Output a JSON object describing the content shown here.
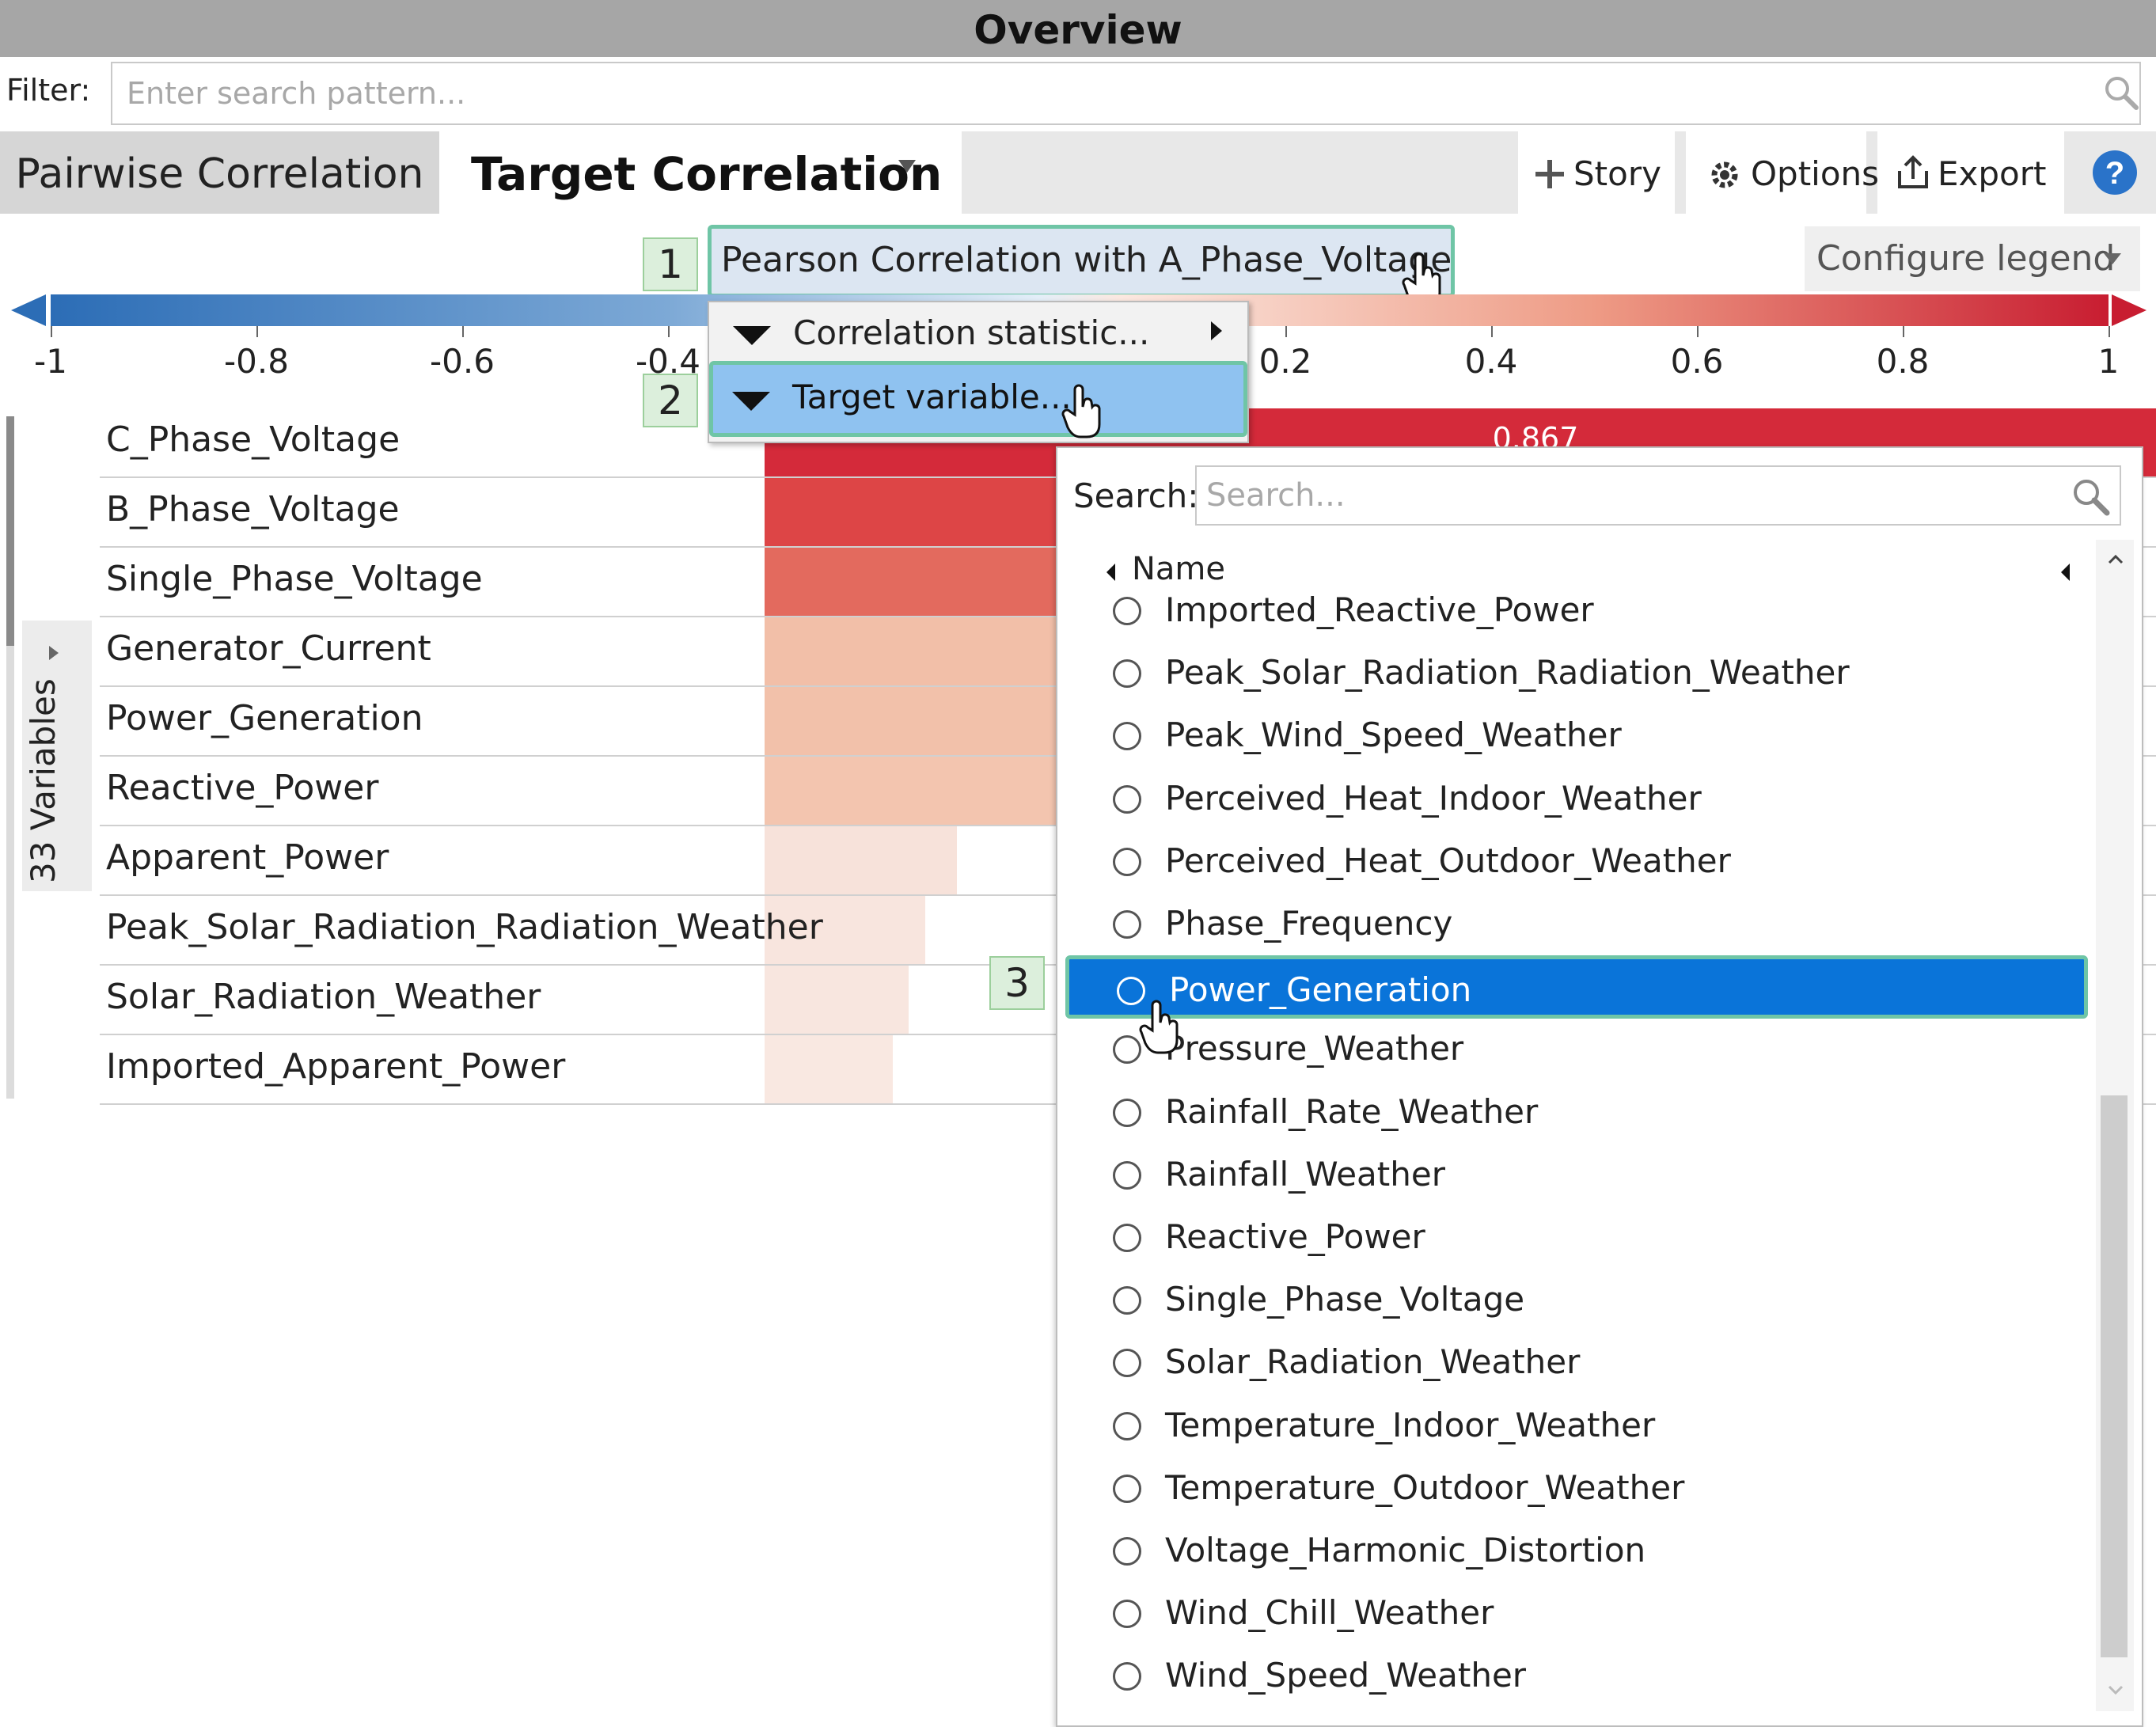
{
  "window": {
    "title": "Overview"
  },
  "filter": {
    "label": "Filter:",
    "placeholder": "Enter search pattern...",
    "icon": "search-icon"
  },
  "tabs": {
    "pairwise": "Pairwise Correlation",
    "target": "Target Correlation"
  },
  "toolbar": {
    "story": "Story",
    "options": "Options",
    "export": "Export",
    "help_icon": "help-icon"
  },
  "header": {
    "annotation_1": "1",
    "selector_label": "Pearson Correlation with A_Phase_Voltage",
    "configure_legend": "Configure legend"
  },
  "legend": {
    "min": -1,
    "max": 1,
    "ticks": [
      "-1",
      "-0.8",
      "-0.6",
      "-0.4",
      "-0.2",
      "0",
      "0.2",
      "0.4",
      "0.6",
      "0.8",
      "1"
    ],
    "colors": {
      "negative": "#2c6db6",
      "neutral": "#f5f5f5",
      "positive": "#c81d31"
    }
  },
  "sidebar": {
    "variables_count_label": "33 Variables"
  },
  "variables": [
    {
      "name": "C_Phase_Voltage",
      "value": 0.867,
      "color": "#d42a3a"
    },
    {
      "name": "B_Phase_Voltage",
      "value": 0.75,
      "color": "#dd4546"
    },
    {
      "name": "Single_Phase_Voltage",
      "value": 0.62,
      "color": "#e36a5e"
    },
    {
      "name": "Generator_Current",
      "value": 0.3,
      "color": "#f2bfa8"
    },
    {
      "name": "Power_Generation",
      "value": 0.29,
      "color": "#f2c1aa"
    },
    {
      "name": "Reactive_Power",
      "value": 0.28,
      "color": "#f3c5af"
    },
    {
      "name": "Apparent_Power",
      "value": 0.12,
      "color": "#f7e2da"
    },
    {
      "name": "Peak_Solar_Radiation_Radiation_Weather",
      "value": 0.1,
      "color": "#f8e5de"
    },
    {
      "name": "Solar_Radiation_Weather",
      "value": 0.09,
      "color": "#f8e6df"
    },
    {
      "name": "Imported_Apparent_Power",
      "value": 0.08,
      "color": "#f9e8e1"
    }
  ],
  "top_bar_value_label": "0.867",
  "context_menu": {
    "annotation_2": "2",
    "items": [
      {
        "label": "Correlation statistic...",
        "has_submenu": true
      },
      {
        "label": "Target variable...",
        "active": true
      }
    ]
  },
  "target_dropdown": {
    "search_label": "Search:",
    "search_placeholder": "Search...",
    "column_header": "Name",
    "annotation_3": "3",
    "options": [
      {
        "label": "Imported_Reactive_Power",
        "selected": false
      },
      {
        "label": "Peak_Solar_Radiation_Radiation_Weather",
        "selected": false
      },
      {
        "label": "Peak_Wind_Speed_Weather",
        "selected": false
      },
      {
        "label": "Perceived_Heat_Indoor_Weather",
        "selected": false
      },
      {
        "label": "Perceived_Heat_Outdoor_Weather",
        "selected": false
      },
      {
        "label": "Phase_Frequency",
        "selected": false
      },
      {
        "label": "Power_Generation",
        "selected": true
      },
      {
        "label": "Pressure_Weather",
        "selected": false
      },
      {
        "label": "Rainfall_Rate_Weather",
        "selected": false
      },
      {
        "label": "Rainfall_Weather",
        "selected": false
      },
      {
        "label": "Reactive_Power",
        "selected": false
      },
      {
        "label": "Single_Phase_Voltage",
        "selected": false
      },
      {
        "label": "Solar_Radiation_Weather",
        "selected": false
      },
      {
        "label": "Temperature_Indoor_Weather",
        "selected": false
      },
      {
        "label": "Temperature_Outdoor_Weather",
        "selected": false
      },
      {
        "label": "Voltage_Harmonic_Distortion",
        "selected": false
      },
      {
        "label": "Wind_Chill_Weather",
        "selected": false
      },
      {
        "label": "Wind_Speed_Weather",
        "selected": false
      }
    ]
  },
  "accent_colors": {
    "selection": "#0a74d9",
    "highlight_border": "#6fc5a6",
    "menu_active": "#8fc2f0"
  }
}
